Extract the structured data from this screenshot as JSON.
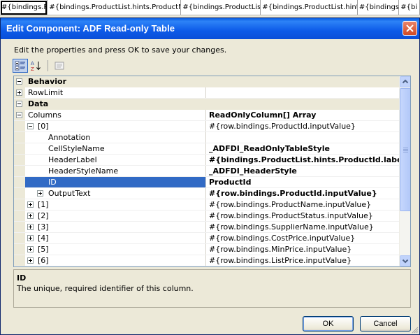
{
  "header_strip": {
    "cells": [
      "#{bindings.P",
      "#{bindings.ProductList.hints.ProductNa",
      "#{bindings.ProductList.",
      "#{bindings.ProductList.hints",
      "#{bindings.P",
      "#{bi"
    ]
  },
  "dialog": {
    "title": "Edit Component: ADF Read-only Table",
    "instructions": "Edit the properties and press OK to save your changes.",
    "toolbar": {
      "categorized_icon": "categorized-icon",
      "alphabetical_icon": "alphabetical-sort-icon",
      "property_pages_icon": "property-pages-icon"
    },
    "grid": {
      "rows": [
        {
          "kind": "category",
          "name": "Behavior",
          "value": ""
        },
        {
          "kind": "prop",
          "name": "RowLimit",
          "value": "",
          "indent": 0,
          "expander": "plus"
        },
        {
          "kind": "category",
          "name": "Data",
          "value": ""
        },
        {
          "kind": "prop",
          "name": "Columns",
          "value": "ReadOnlyColumn[] Array",
          "indent": 0,
          "expander": "minus",
          "bold": true
        },
        {
          "kind": "prop",
          "name": "[0]",
          "value": "#{row.bindings.ProductId.inputValue}",
          "indent": 1,
          "expander": "minus"
        },
        {
          "kind": "prop",
          "name": "Annotation",
          "value": "",
          "indent": 2
        },
        {
          "kind": "prop",
          "name": "CellStyleName",
          "value": "_ADFDI_ReadOnlyTableStyle",
          "indent": 2,
          "bold": true
        },
        {
          "kind": "prop",
          "name": "HeaderLabel",
          "value": "#{bindings.ProductList.hints.ProductId.label}",
          "indent": 2,
          "bold": true
        },
        {
          "kind": "prop",
          "name": "HeaderStyleName",
          "value": "_ADFDI_HeaderStyle",
          "indent": 2,
          "bold": true
        },
        {
          "kind": "prop",
          "name": "ID",
          "value": "ProductId",
          "indent": 2,
          "bold": true,
          "selected": true
        },
        {
          "kind": "prop",
          "name": "OutputText",
          "value": "#{row.bindings.ProductId.inputValue}",
          "indent": 2,
          "expander": "plus",
          "bold": true
        },
        {
          "kind": "prop",
          "name": "[1]",
          "value": "#{row.bindings.ProductName.inputValue}",
          "indent": 1,
          "expander": "plus"
        },
        {
          "kind": "prop",
          "name": "[2]",
          "value": "#{row.bindings.ProductStatus.inputValue}",
          "indent": 1,
          "expander": "plus"
        },
        {
          "kind": "prop",
          "name": "[3]",
          "value": "#{row.bindings.SupplierName.inputValue}",
          "indent": 1,
          "expander": "plus"
        },
        {
          "kind": "prop",
          "name": "[4]",
          "value": "#{row.bindings.CostPrice.inputValue}",
          "indent": 1,
          "expander": "plus"
        },
        {
          "kind": "prop",
          "name": "[5]",
          "value": "#{row.bindings.MinPrice.inputValue}",
          "indent": 1,
          "expander": "plus"
        },
        {
          "kind": "prop",
          "name": "[6]",
          "value": "#{row.bindings.ListPrice.inputValue}",
          "indent": 1,
          "expander": "plus"
        }
      ]
    },
    "description": {
      "title": "ID",
      "text": "The unique, required identifier of this column."
    },
    "buttons": {
      "ok": "OK",
      "cancel": "Cancel"
    }
  },
  "colors": {
    "title_bar": "#0a5de1",
    "selection": "#316ac5",
    "dialog_bg": "#ece9d8"
  }
}
